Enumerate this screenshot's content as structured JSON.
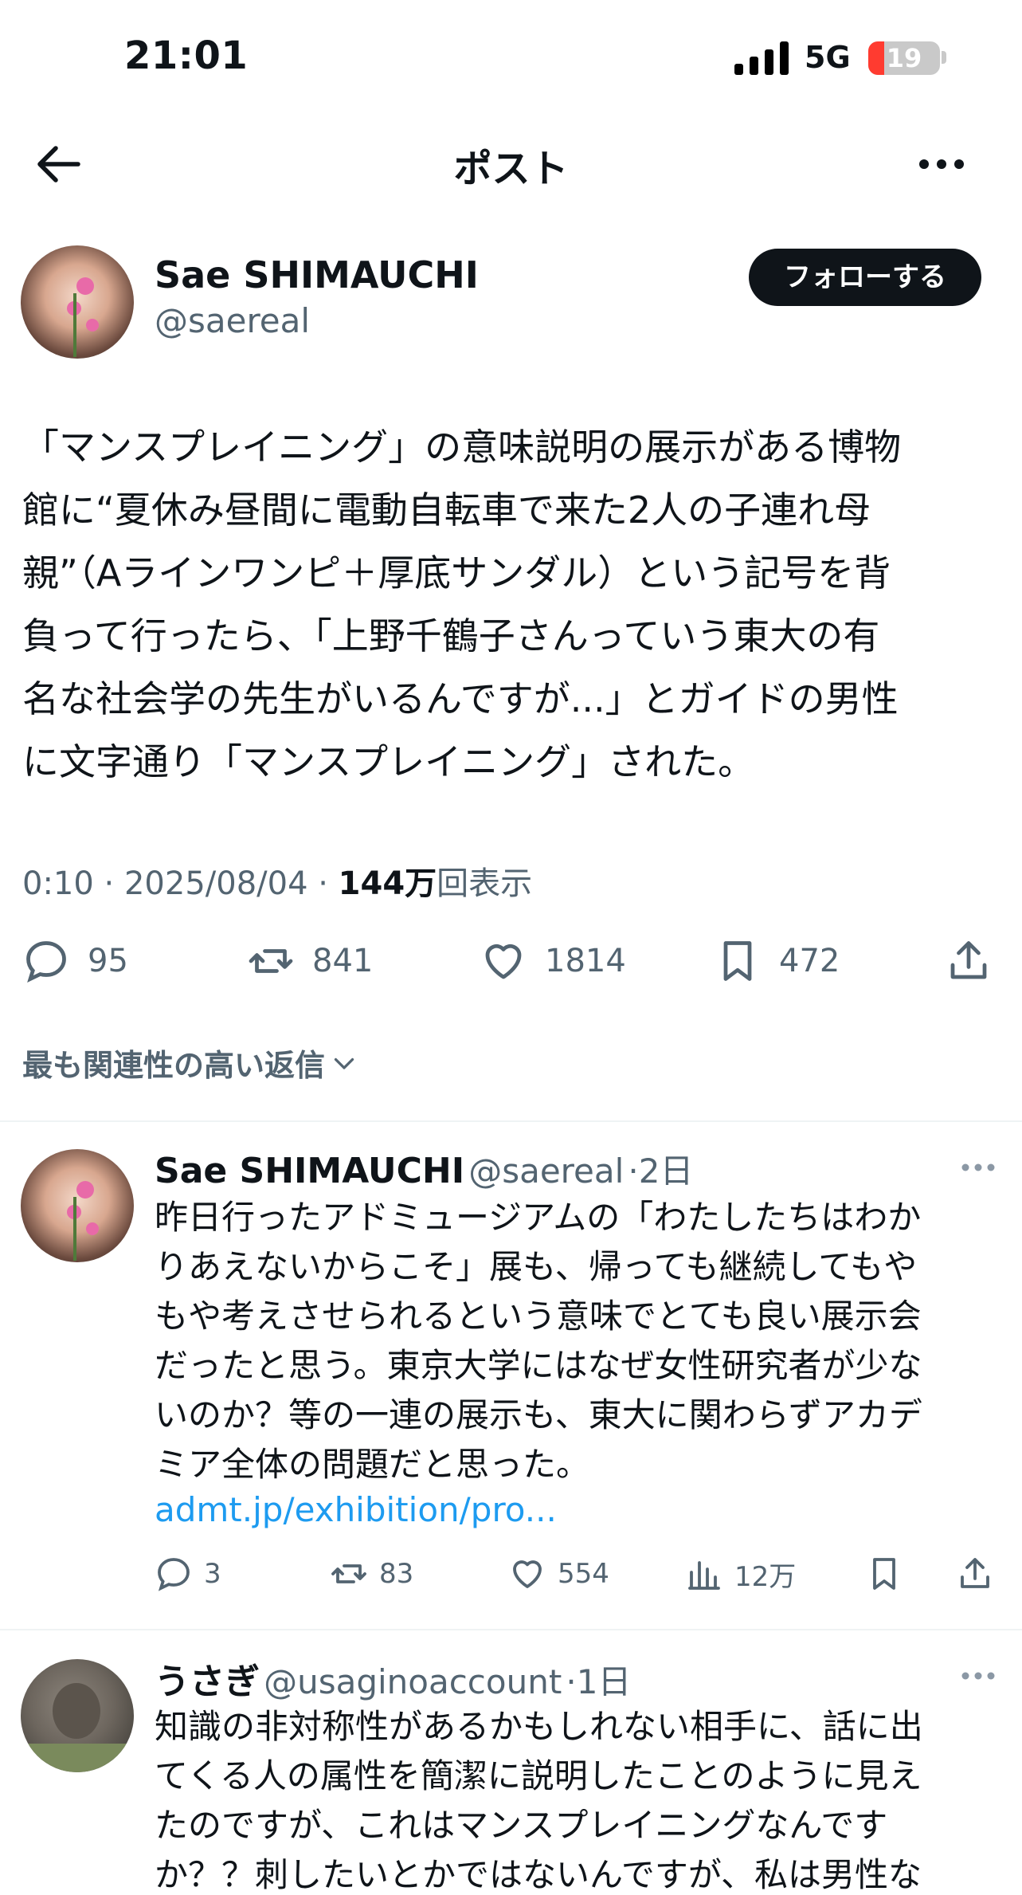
{
  "status_bar": {
    "time": "21:01",
    "network": "5G",
    "battery": "19"
  },
  "header": {
    "title": "ポスト"
  },
  "post": {
    "author_name": "Sae SHIMAUCHI",
    "author_handle": "@saereal",
    "follow_label": "フォローする",
    "text": "「マンスプレイニング」の意味説明の展示がある博物\n館に“夏休み昼間に電動自転車で来た2人の子連れ母\n親”（Aラインワンピ＋厚底サンダル）という記号を背\n負って行ったら、「上野千鶴子さんっていう東大の有\n名な社会学の先生がいるんですが...」とガイドの男性\nに文字通り「マンスプレイニング」された。",
    "time": "0:10 · 2025/08/04 · ",
    "views_count": "144万",
    "views_label": "回表示",
    "replies": "95",
    "reposts": "841",
    "likes": "1814",
    "bookmarks": "472"
  },
  "replies_filter": "最も関連性の高い返信",
  "replies": [
    {
      "name": "Sae SHIMAUCHI",
      "handle": "@saereal",
      "age": "·2日",
      "text": "昨日行ったアドミュージアムの「わたしたちはわか\nりあえないからこそ」展も、帰っても継続してもや\nもや考えさせられるという意味でとても良い展示会\nだったと思う。東京大学にはなぜ女性研究者が少な\nいのか？等の一連の展示も、東大に関わらずアカデ\nミア全体の問題だと思った。",
      "link": "admt.jp/exhibition/pro...",
      "replies": "3",
      "reposts": "83",
      "likes": "554",
      "views": "12万"
    },
    {
      "name": "うさぎ",
      "handle": "@usaginoaccount",
      "age": "·1日",
      "text": "知識の非対称性があるかもしれない相手に、話に出\nてくる人の属性を簡潔に説明したことのように見え\nたのですが、これはマンスプレイニングなんです\nか？？刺したいとかではないんですが、私は男性な"
    }
  ]
}
